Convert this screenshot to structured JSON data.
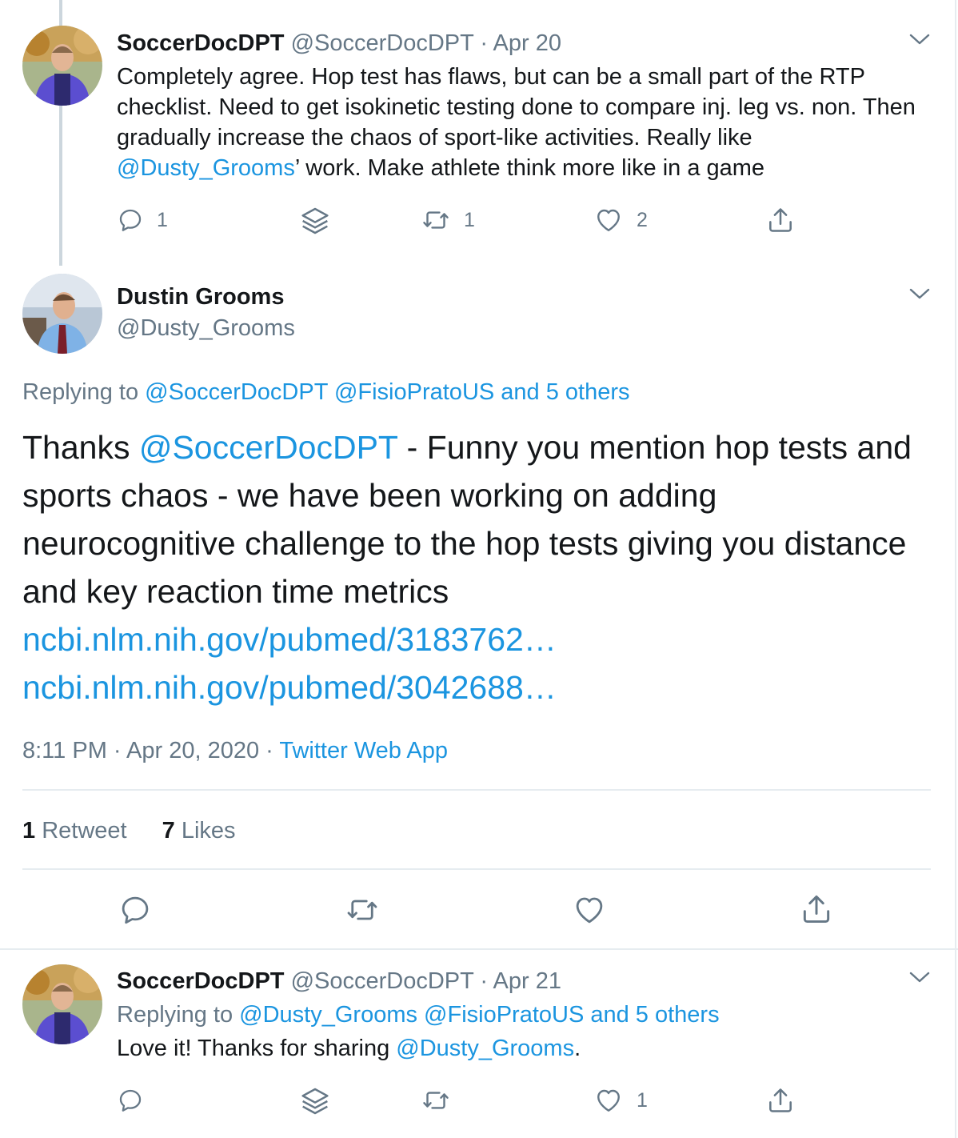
{
  "tweet1": {
    "display_name": "SoccerDocDPT",
    "handle": "@SoccerDocDPT",
    "sep": "·",
    "date": "Apr 20",
    "text_1": "Completely agree. Hop test has flaws, but can be a small part of the RTP checklist. Need to get isokinetic testing done to compare inj. leg vs. non. Then gradually increase the chaos of sport-like activities. Really like ",
    "mention": "@Dusty_Grooms",
    "text_2": "’ work. Make athlete think more like in a game",
    "reply_count": "1",
    "retweet_count": "1",
    "like_count": "2"
  },
  "main": {
    "display_name": "Dustin Grooms",
    "handle": "@Dusty_Grooms",
    "replying_label": "Replying to",
    "replying_mentions": "@SoccerDocDPT @FisioPratoUS and 5 others",
    "text_1": "Thanks ",
    "mention": "@SoccerDocDPT",
    "text_2": " - Funny you mention hop tests and sports chaos - we have been working on adding neurocognitive challenge to the hop tests giving you distance and key reaction time metrics",
    "link_1": "ncbi.nlm.nih.gov/pubmed/3183762…",
    "link_2": "ncbi.nlm.nih.gov/pubmed/3042688…",
    "time": "8:11 PM · Apr 20, 2020",
    "sep": "·",
    "source": "Twitter Web App",
    "retweets_count": "1",
    "retweets_label": "Retweet",
    "likes_count": "7",
    "likes_label": "Likes"
  },
  "tweet3": {
    "display_name": "SoccerDocDPT",
    "handle": "@SoccerDocDPT",
    "sep": "·",
    "date": "Apr 21",
    "replying_label": "Replying to",
    "replying_mentions": "@Dusty_Grooms @FisioPratoUS and 5 others",
    "text_1": "Love it! Thanks for sharing ",
    "mention": "@Dusty_Grooms",
    "text_2": ".",
    "like_count": "1"
  },
  "icons": [
    "reply-icon",
    "stack-icon",
    "retweet-icon",
    "heart-icon",
    "share-icon",
    "chevron-down-icon"
  ],
  "colors": {
    "link": "#1b95e0",
    "secondary": "#657786",
    "divider": "#e6ecf0",
    "thread_line": "#ccd6dd"
  }
}
